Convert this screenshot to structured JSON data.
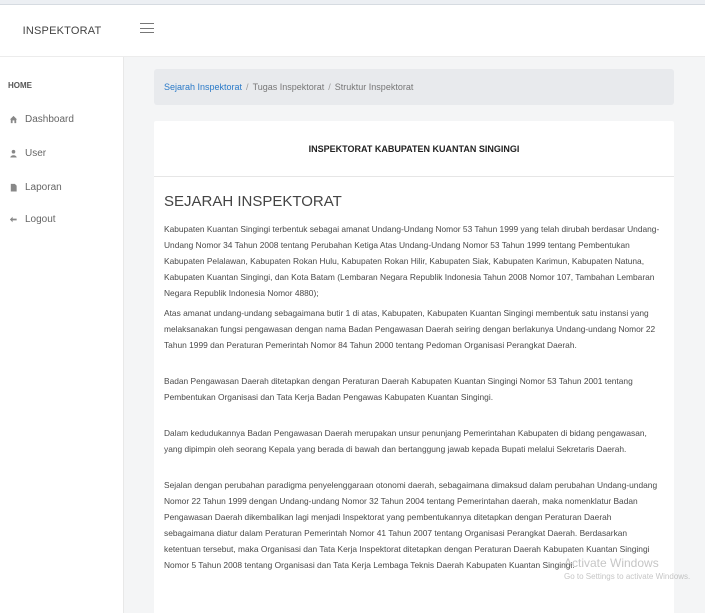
{
  "topbar": {
    "brand": "INSPEKTORAT",
    "menu_icon": "hamburger-icon"
  },
  "sidebar": {
    "heading": "HOME",
    "items": [
      {
        "label": "Dashboard",
        "icon": "dashboard-icon"
      },
      {
        "label": "User",
        "icon": "user-icon"
      },
      {
        "label": "Laporan",
        "icon": "file-icon"
      },
      {
        "label": "Logout",
        "icon": "logout-icon"
      }
    ]
  },
  "breadcrumb": {
    "items": [
      "Sejarah Inspektorat",
      "Tugas Inspektorat",
      "Struktur Inspektorat"
    ],
    "separator": "/"
  },
  "card": {
    "header": "INSPEKTORAT KABUPATEN KUANTAN SINGINGI",
    "section_title": "SEJARAH INSPEKTORAT",
    "paragraphs": [
      "Kabupaten Kuantan Singingi terbentuk sebagai amanat Undang-Undang Nomor 53 Tahun 1999 yang telah dirubah berdasar Undang-Undang Nomor 34 Tahun 2008 tentang Perubahan Ketiga Atas Undang-Undang Nomor 53 Tahun 1999 tentang Pembentukan Kabupaten Pelalawan, Kabupaten Rokan Hulu, Kabupaten Rokan Hilir, Kabupaten Siak, Kabupaten Karimun, Kabupaten Natuna, Kabupaten Kuantan Singingi, dan Kota Batam (Lembaran Negara Republik Indonesia Tahun 2008 Nomor 107, Tambahan Lembaran Negara Republik Indonesia Nomor 4880);",
      "Atas amanat undang-undang sebagaimana butir 1 di atas, Kabupaten, Kabupaten Kuantan Singingi membentuk satu instansi yang melaksanakan fungsi pengawasan dengan nama  Badan Pengawasan Daerah seiring dengan berlakunya Undang-undang Nomor 22 Tahun 1999 dan Peraturan Pemerintah Nomor 84 Tahun 2000 tentang Pedoman Organisasi Perangkat Daerah.",
      "Badan Pengawasan Daerah ditetapkan dengan Peraturan Daerah Kabupaten Kuantan Singingi Nomor 53 Tahun 2001 tentang Pembentukan Organisasi dan Tata Kerja Badan Pengawas Kabupaten Kuantan Singingi.",
      "Dalam kedudukannya Badan Pengawasan Daerah merupakan unsur penunjang Pemerintahan Kabupaten di bidang pengawasan, yang dipimpin oleh seorang Kepala yang berada di bawah dan bertanggung jawab kepada Bupati melalui Sekretaris Daerah.",
      "Sejalan dengan perubahan paradigma penyelenggaraan otonomi daerah, sebagaimana dimaksud dalam perubahan Undang-undang Nomor 22 Tahun 1999 dengan Undang-undang Nomor 32 Tahun 2004 tentang Pemerintahan daerah, maka nomenklatur Badan Pengawasan Daerah dikembalikan lagi menjadi Inspektorat yang pembentukannya ditetapkan dengan Peraturan Daerah sebagaimana diatur dalam Peraturan Pemerintah Nomor 41 Tahun 2007 tentang Organisasi Perangkat Daerah. Berdasarkan ketentuan tersebut, maka Organisasi dan Tata Kerja Inspektorat ditetapkan dengan Peraturan Daerah Kabupaten Kuantan Singingi Nomor 5 Tahun 2008 tentang Organisasi dan Tata Kerja Lembaga Teknis Daerah Kabupaten Kuantan Singingi."
    ]
  },
  "watermark": {
    "line1": "Activate Windows",
    "line2": "Go to Settings to activate Windows."
  }
}
